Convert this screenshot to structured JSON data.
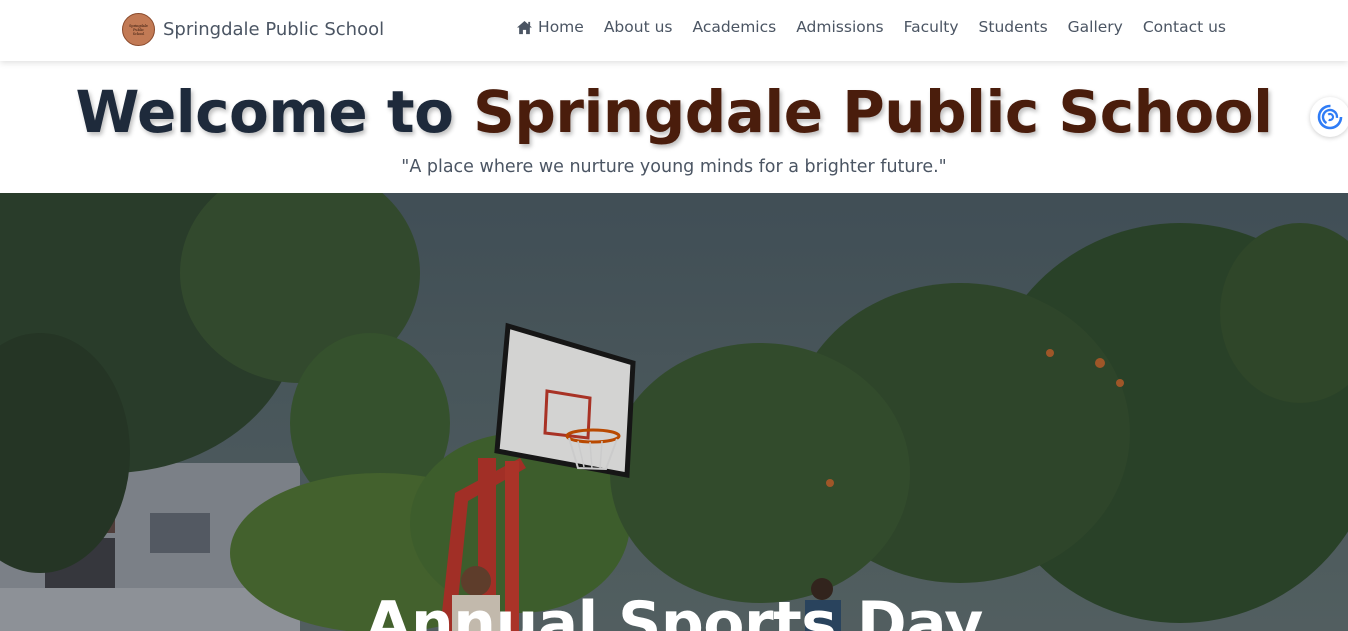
{
  "brand": {
    "name": "Springdale Public School",
    "logo_text": [
      "Springdale",
      "Public",
      "School"
    ]
  },
  "nav": {
    "items": [
      {
        "label": "Home",
        "icon": "home-icon"
      },
      {
        "label": "About us"
      },
      {
        "label": "Academics"
      },
      {
        "label": "Admissions"
      },
      {
        "label": "Faculty"
      },
      {
        "label": "Students"
      },
      {
        "label": "Gallery"
      },
      {
        "label": "Contact us"
      }
    ]
  },
  "hero": {
    "title_prefix": "Welcome to ",
    "title_accent": "Springdale Public School",
    "tagline": "\"A place where we nurture young minds for a brighter future.\""
  },
  "carousel": {
    "slide_title": "Annual Sports Day",
    "image": "basketball-court-photo"
  },
  "colors": {
    "accent": "#4a1d0c",
    "title": "#1e2a3b",
    "nav_text": "#4b5563"
  }
}
